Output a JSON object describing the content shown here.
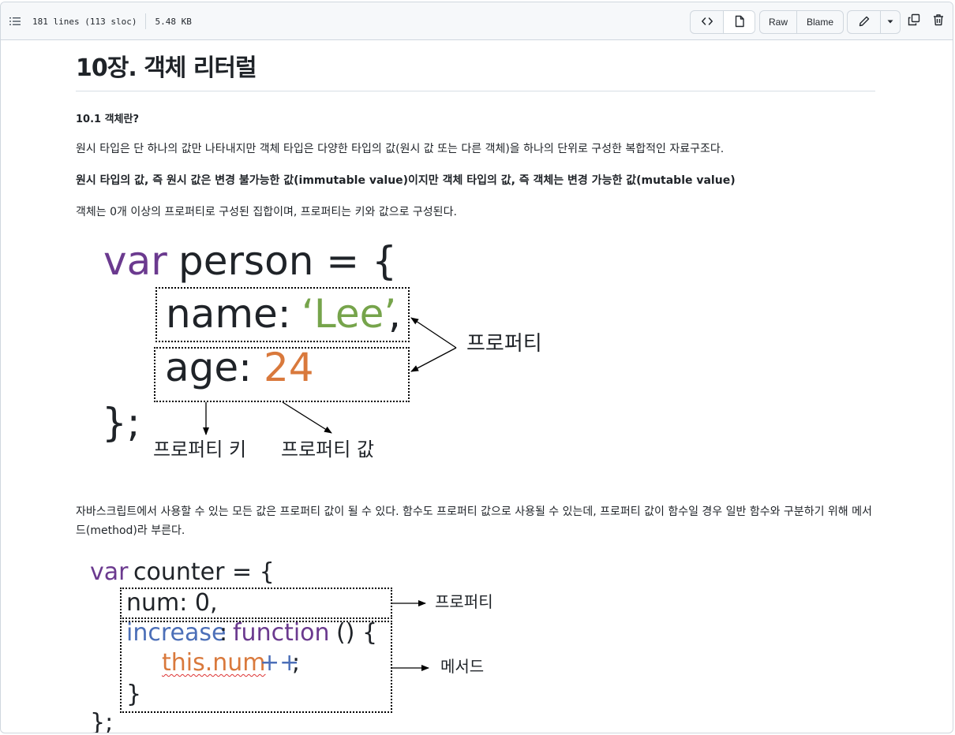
{
  "toolbar": {
    "lines_info": "181 lines (113 sloc)",
    "size": "5.48 KB",
    "raw_label": "Raw",
    "blame_label": "Blame"
  },
  "heading": "10장. 객체 리터럴",
  "section_title": "10.1 객체란?",
  "para1": "원시 타입은 단 하나의 값만 나타내지만 객체 타입은 다양한 타입의 값(원시 값 또는 다른 객체)을 하나의 단위로 구성한 복합적인 자료구조다.",
  "para2": "원시 타입의 값, 즉 원시 값은 변경 불가능한 값(immutable value)이지만 객체 타입의 값, 즉 객체는 변경 가능한 값(mutable value)",
  "para3": "객체는 0개 이상의 프로퍼티로 구성된 집합이며, 프로퍼티는 키와 값으로 구성된다.",
  "diagram1": {
    "kw_var": "var",
    "decl": "person = {",
    "name_key": "name:",
    "name_val": "‘Lee’",
    "comma": ",",
    "age_key": "age:",
    "age_val": "24",
    "close": "};",
    "label_property": "프로퍼티",
    "label_key": "프로퍼티 키",
    "label_value": "프로퍼티 값"
  },
  "para4": "자바스크립트에서 사용할 수 있는 모든 값은 프로퍼티 값이 될 수 있다. 함수도 프로퍼티 값으로 사용될 수 있는데, 프로퍼티 값이 함수일 경우 일반 함수와 구분하기 위해 메서드(method)라 부른다.",
  "diagram2": {
    "kw_var": "var",
    "decl": "counter = {",
    "num_line": "num: 0,",
    "increase": "increase",
    "colon": ":",
    "kw_function": "function",
    "paren": "() {",
    "this_num": "this.num",
    "plusplus": "++",
    "semi": ";",
    "inner_close": "}",
    "close": "};",
    "label_property": "프로퍼티",
    "label_method": "메서드"
  }
}
